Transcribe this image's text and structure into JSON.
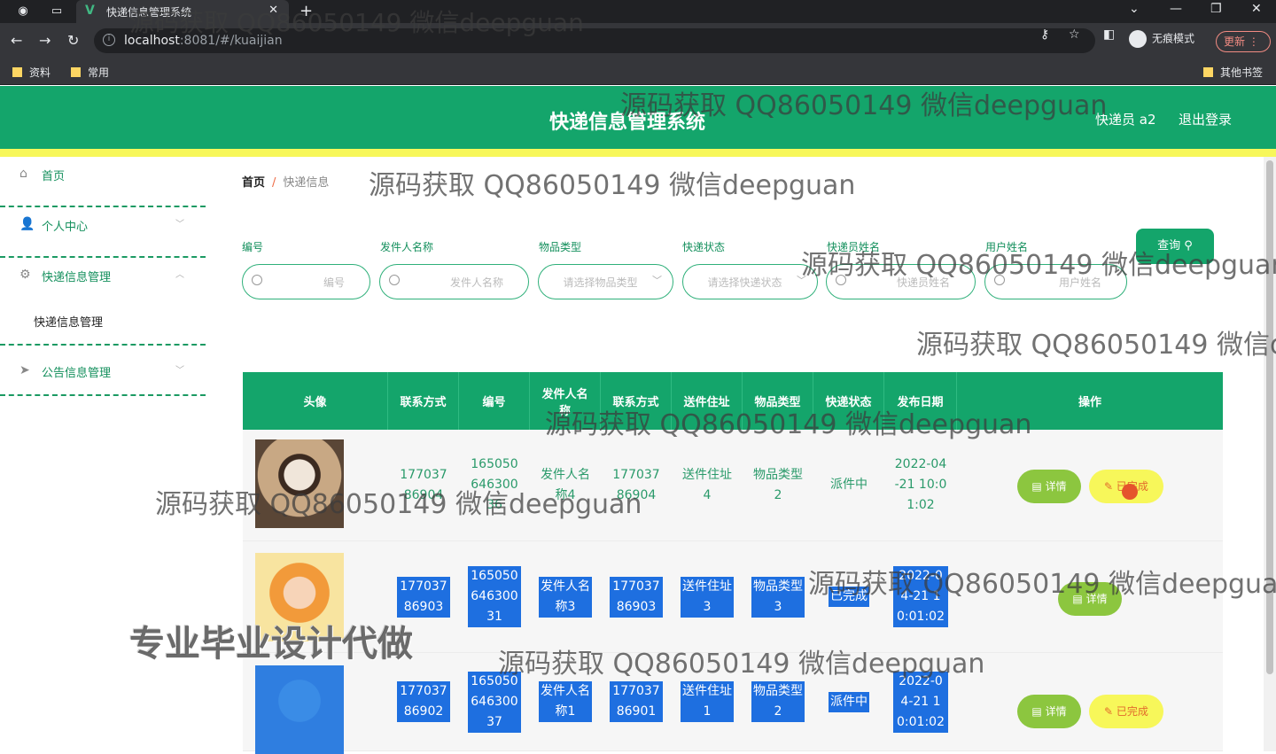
{
  "browser": {
    "tab_title": "快递信息管理系统",
    "url_host": "localhost",
    "url_path": ":8081/#/kuaijian",
    "incognito_label": "无痕模式",
    "update_label": "更新",
    "bookmarks": [
      "资料",
      "常用"
    ],
    "other_bookmarks": "其他书签"
  },
  "header": {
    "title": "快递信息管理系统",
    "user": "快递员 a2",
    "logout": "退出登录"
  },
  "sidebar": {
    "items": [
      {
        "label": "首页",
        "icon": "home-icon"
      },
      {
        "label": "个人中心",
        "icon": "user-icon"
      },
      {
        "label": "快递信息管理",
        "icon": "settings-icon"
      },
      {
        "label": "公告信息管理",
        "icon": "send-icon"
      }
    ],
    "submenu_item": "快递信息管理"
  },
  "breadcrumb": {
    "home": "首页",
    "sep": "/",
    "current": "快递信息"
  },
  "filters": {
    "labels": [
      "编号",
      "发件人名称",
      "物品类型",
      "快递状态",
      "快递员姓名",
      "用户姓名"
    ],
    "placeholders": [
      "编号",
      "发件人名称",
      "请选择物品类型",
      "请选择快递状态",
      "快递员姓名",
      "用户姓名"
    ],
    "query_button": "查询"
  },
  "table": {
    "headers": [
      "头像",
      "联系方式",
      "编号",
      "发件人名称",
      "联系方式",
      "送件住址",
      "物品类型",
      "快递状态",
      "发布日期",
      "操作"
    ],
    "rows": [
      {
        "contact1": "17703786904",
        "number": "16505064630036",
        "sender": "发件人名称4",
        "contact2": "17703786904",
        "address": "送件住址4",
        "type": "物品类型2",
        "status": "派件中",
        "date": "2022-04-21 10:01:02"
      },
      {
        "contact1": "17703786903",
        "number": "16505064630031",
        "sender": "发件人名称3",
        "contact2": "17703786903",
        "address": "送件住址3",
        "type": "物品类型3",
        "status": "已完成",
        "date": "2022-04-21 10:01:02"
      },
      {
        "contact1": "17703786902",
        "number": "16505064630037",
        "sender": "发件人名称1",
        "contact2": "17703786901",
        "address": "送件住址1",
        "type": "物品类型2",
        "status": "派件中",
        "date": "2022-04-21 10:01:02"
      }
    ],
    "btn_detail": "详情",
    "btn_done": "已完成"
  },
  "watermarks": {
    "text": "源码获取 QQ86050149 微信deepguan",
    "text_cut": "源码获取 QQ86050149 微信d",
    "banner": "专业毕业设计代做"
  }
}
